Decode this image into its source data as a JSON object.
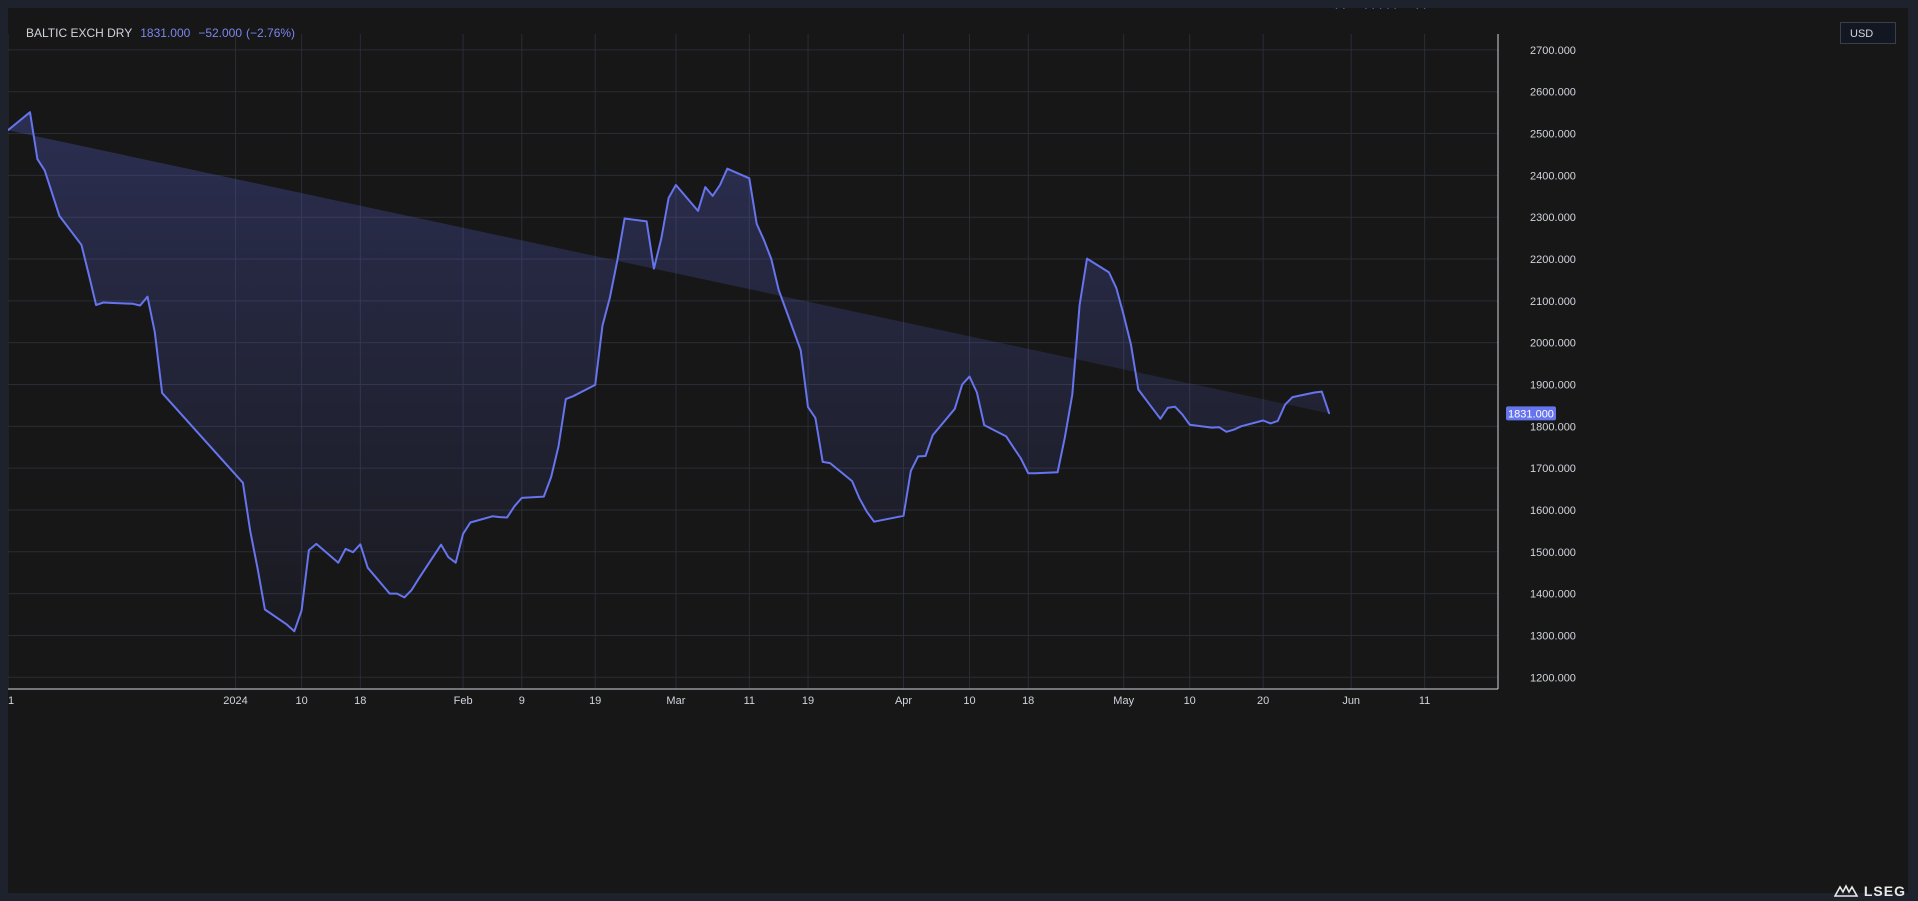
{
  "legend": {
    "symbol": "BALTIC EXCH DRY",
    "last": "1831.000",
    "change": "−52.000",
    "change_pct": "(−2.76%)"
  },
  "currency_button": "USD",
  "brand": "LSEG",
  "colors": {
    "line": "#6674ee",
    "last_tag": "#6674ee",
    "background": "#171717",
    "grid": "#2a2d35",
    "text": "#d1d4dc"
  },
  "chart_data": {
    "type": "area",
    "x": [
      "2023-12-01",
      "2023-12-04",
      "2023-12-05",
      "2023-12-06",
      "2023-12-07",
      "2023-12-08",
      "2023-12-11",
      "2023-12-12",
      "2023-12-13",
      "2023-12-14",
      "2023-12-15",
      "2023-12-18",
      "2023-12-19",
      "2023-12-20",
      "2023-12-21",
      "2023-12-22",
      "2024-01-02",
      "2024-01-03",
      "2024-01-04",
      "2024-01-05",
      "2024-01-08",
      "2024-01-09",
      "2024-01-10",
      "2024-01-11",
      "2024-01-12",
      "2024-01-15",
      "2024-01-16",
      "2024-01-17",
      "2024-01-18",
      "2024-01-19",
      "2024-01-22",
      "2024-01-23",
      "2024-01-24",
      "2024-01-25",
      "2024-01-26",
      "2024-01-29",
      "2024-01-30",
      "2024-01-31",
      "2024-02-01",
      "2024-02-02",
      "2024-02-05",
      "2024-02-06",
      "2024-02-07",
      "2024-02-08",
      "2024-02-09",
      "2024-02-12",
      "2024-02-13",
      "2024-02-14",
      "2024-02-15",
      "2024-02-16",
      "2024-02-19",
      "2024-02-20",
      "2024-02-21",
      "2024-02-22",
      "2024-02-23",
      "2024-02-26",
      "2024-02-27",
      "2024-02-28",
      "2024-02-29",
      "2024-03-01",
      "2024-03-04",
      "2024-03-05",
      "2024-03-06",
      "2024-03-07",
      "2024-03-08",
      "2024-03-11",
      "2024-03-12",
      "2024-03-13",
      "2024-03-14",
      "2024-03-15",
      "2024-03-18",
      "2024-03-19",
      "2024-03-20",
      "2024-03-21",
      "2024-03-22",
      "2024-03-25",
      "2024-03-26",
      "2024-03-27",
      "2024-03-28",
      "2024-04-01",
      "2024-04-02",
      "2024-04-03",
      "2024-04-04",
      "2024-04-05",
      "2024-04-08",
      "2024-04-09",
      "2024-04-10",
      "2024-04-11",
      "2024-04-12",
      "2024-04-15",
      "2024-04-16",
      "2024-04-17",
      "2024-04-18",
      "2024-04-19",
      "2024-04-22",
      "2024-04-23",
      "2024-04-24",
      "2024-04-25",
      "2024-04-26",
      "2024-04-29",
      "2024-04-30",
      "2024-05-01",
      "2024-05-02",
      "2024-05-03",
      "2024-05-06",
      "2024-05-07",
      "2024-05-08",
      "2024-05-09",
      "2024-05-10",
      "2024-05-13",
      "2024-05-14",
      "2024-05-15",
      "2024-05-16",
      "2024-05-17",
      "2024-05-20",
      "2024-05-21",
      "2024-05-22",
      "2024-05-23",
      "2024-05-24",
      "2024-05-27",
      "2024-05-28",
      "2024-05-29",
      "2024-05-30",
      "2024-05-31",
      "2024-06-03",
      "2024-06-04",
      "2024-06-05",
      "2024-06-06",
      "2024-06-07",
      "2024-06-10",
      "2024-06-11"
    ],
    "y": [
      2508,
      2551,
      2439,
      2412,
      2358,
      2303,
      2234,
      2164,
      2090,
      2096,
      2095,
      2093,
      2089,
      2110,
      2025,
      1880,
      1665,
      1550,
      1460,
      1362,
      1326,
      1310,
      1360,
      1504,
      1519,
      1474,
      1507,
      1499,
      1518,
      1462,
      1400,
      1400,
      1391,
      1409,
      1437,
      1517,
      1487,
      1474,
      1543,
      1570,
      1585,
      1583,
      1582,
      1609,
      1629,
      1632,
      1679,
      1752,
      1865,
      1872,
      1899,
      2041,
      2108,
      2195,
      2297,
      2290,
      2177,
      2249,
      2346,
      2377,
      2315,
      2372,
      2351,
      2377,
      2416,
      2393,
      2284,
      2245,
      2200,
      2126,
      1982,
      1846,
      1820,
      1715,
      1712,
      1669,
      1628,
      1596,
      1572,
      1586,
      1693,
      1728,
      1729,
      1779,
      1842,
      1900,
      1919,
      1881,
      1803,
      1776,
      1749,
      1723,
      1688,
      1688,
      1690,
      1774,
      1876,
      2090,
      2201,
      2168,
      2131,
      2066,
      1995,
      1888,
      1818,
      1844,
      1847,
      1828,
      1804,
      1797,
      1798,
      1787,
      1792,
      1800,
      1814,
      1807,
      1813,
      1852,
      1870,
      1881,
      1883,
      1831
    ],
    "x_tick_labels": [
      {
        "date": "2023-12-01",
        "label": "1"
      },
      {
        "date": "2024-01-01",
        "label": "2024"
      },
      {
        "date": "2024-01-10",
        "label": "10"
      },
      {
        "date": "2024-01-18",
        "label": "18"
      },
      {
        "date": "2024-02-01",
        "label": "Feb"
      },
      {
        "date": "2024-02-09",
        "label": "9"
      },
      {
        "date": "2024-02-19",
        "label": "19"
      },
      {
        "date": "2024-03-01",
        "label": "Mar"
      },
      {
        "date": "2024-03-11",
        "label": "11"
      },
      {
        "date": "2024-03-19",
        "label": "19"
      },
      {
        "date": "2024-04-01",
        "label": "Apr"
      },
      {
        "date": "2024-04-10",
        "label": "10"
      },
      {
        "date": "2024-04-18",
        "label": "18"
      },
      {
        "date": "2024-05-01",
        "label": "May"
      },
      {
        "date": "2024-05-10",
        "label": "10"
      },
      {
        "date": "2024-05-20",
        "label": "20"
      },
      {
        "date": "2024-06-01",
        "label": "Jun"
      },
      {
        "date": "2024-06-11",
        "label": "11"
      }
    ],
    "y_ticks": [
      "1200.000",
      "1300.000",
      "1400.000",
      "1500.000",
      "1600.000",
      "1700.000",
      "1800.000",
      "1900.000",
      "2000.000",
      "2100.000",
      "2200.000",
      "2300.000",
      "2400.000",
      "2500.000",
      "2600.000",
      "2700.000"
    ],
    "ylim": [
      1172,
      2738
    ],
    "xlim": [
      "2023-12-01",
      "2024-06-21"
    ],
    "last_value_label": "1831.000",
    "grid": true
  }
}
